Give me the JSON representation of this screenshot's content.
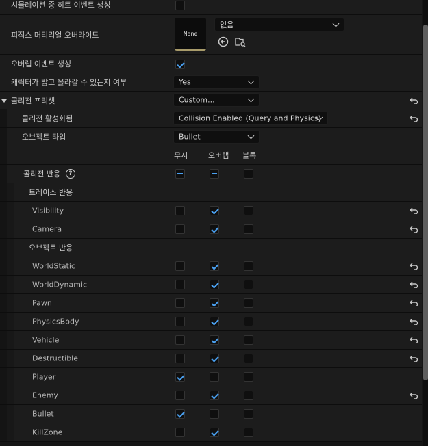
{
  "rows": {
    "sim_hit": {
      "label": "시뮬레이션 중 히트 이벤트 생성",
      "checked": false
    },
    "phys_mat": {
      "label": "피직스 머티리얼 오버라이드",
      "thumb_text": "None",
      "dropdown_value": "없음",
      "icons": [
        "browse-back-icon",
        "folder-search-icon"
      ]
    },
    "overlap_events": {
      "label": "오버랩 이벤트 생성",
      "checked": true
    },
    "can_step_up": {
      "label": "캐릭터가 밟고 올라갈 수 있는지 여부",
      "value": "Yes"
    },
    "preset": {
      "label": "콜리전 프리셋",
      "value": "Custom..."
    },
    "collision_enabled": {
      "label": "콜리전 활성화됨",
      "value": "Collision Enabled (Query and Physics)"
    },
    "object_type": {
      "label": "오브젝트 타입",
      "value": "Bullet"
    }
  },
  "columns": {
    "ignore": "무시",
    "overlap": "오버랩",
    "block": "블록"
  },
  "collision_response": {
    "label": "콜리전 반응",
    "help": "?"
  },
  "trace_header": "트레이스 반응",
  "object_header": "오브젝트 반응",
  "trace_rows": [
    {
      "label": "Visibility",
      "state": "overlap",
      "reset": true
    },
    {
      "label": "Camera",
      "state": "overlap",
      "reset": true
    }
  ],
  "object_rows": [
    {
      "label": "WorldStatic",
      "state": "overlap",
      "reset": true
    },
    {
      "label": "WorldDynamic",
      "state": "overlap",
      "reset": true
    },
    {
      "label": "Pawn",
      "state": "overlap",
      "reset": true
    },
    {
      "label": "PhysicsBody",
      "state": "overlap",
      "reset": true
    },
    {
      "label": "Vehicle",
      "state": "overlap",
      "reset": true
    },
    {
      "label": "Destructible",
      "state": "overlap",
      "reset": true
    },
    {
      "label": "Player",
      "state": "ignore",
      "reset": false
    },
    {
      "label": "Enemy",
      "state": "overlap",
      "reset": true
    },
    {
      "label": "Bullet",
      "state": "ignore",
      "reset": false
    },
    {
      "label": "KillZone",
      "state": "overlap",
      "reset": false
    }
  ],
  "accent_color": "#4aa0f0"
}
